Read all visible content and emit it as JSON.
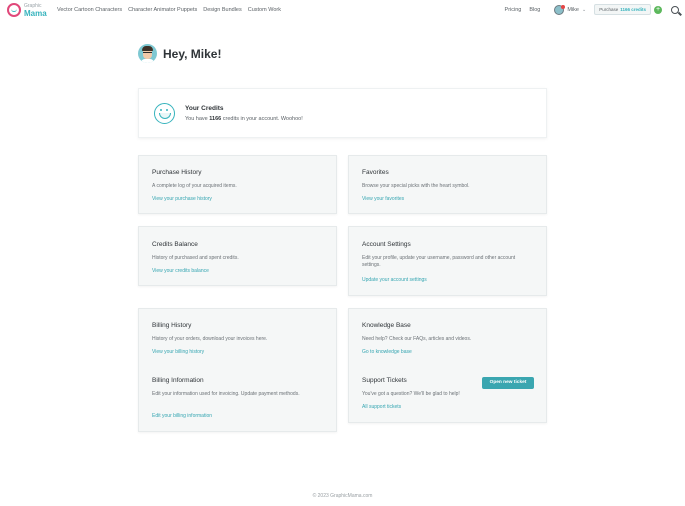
{
  "brand": {
    "small": "Graphic",
    "big": "Mama"
  },
  "nav": {
    "items": [
      "Vector Cartoon Characters",
      "Character Animator Puppets",
      "Design Bundles",
      "Custom Work"
    ],
    "pricing": "Pricing",
    "blog": "Blog",
    "user_name": "Mike",
    "credits_label": "Purchase",
    "credits_value": "1166 credits",
    "plus": "+"
  },
  "greeting": "Hey, Mike!",
  "credits_card": {
    "title": "Your Credits",
    "line_pre": "You have",
    "line_value": "1166",
    "line_post": "credits in your account. Woohoo!"
  },
  "cards": {
    "purchase_history": {
      "title": "Purchase History",
      "desc": "A complete log of your acquired items.",
      "link": "View your purchase history"
    },
    "favorites": {
      "title": "Favorites",
      "desc": "Browse your special picks with the heart symbol.",
      "link": "View your favorites"
    },
    "credits_balance": {
      "title": "Credits Balance",
      "desc": "History of purchased and spent credits.",
      "link": "View your credits balance"
    },
    "account_settings": {
      "title": "Account Settings",
      "desc": "Edit your profile, update your username, password and other account settings.",
      "link": "Update your account settings"
    },
    "billing_history": {
      "title": "Billing History",
      "desc": "History of your orders, download your invoices here.",
      "link": "View your billing history"
    },
    "billing_information": {
      "title": "Billing Information",
      "desc": "Edit your information used for invoicing. Update payment methods.",
      "link": "Edit your billing information"
    },
    "knowledge_base": {
      "title": "Knowledge Base",
      "desc": "Need help? Check our FAQs, articles and videos.",
      "link": "Go to knowledge base"
    },
    "support_tickets": {
      "title": "Support Tickets",
      "desc": "You've got a question? We'll be glad to help!",
      "link": "All support tickets",
      "button": "Open new ticket"
    }
  },
  "footer": "© 2023 GraphicMama.com",
  "colors": {
    "accent": "#36b3bd",
    "button": "#3aa6b0",
    "card_bg": "#f5f7f7"
  }
}
